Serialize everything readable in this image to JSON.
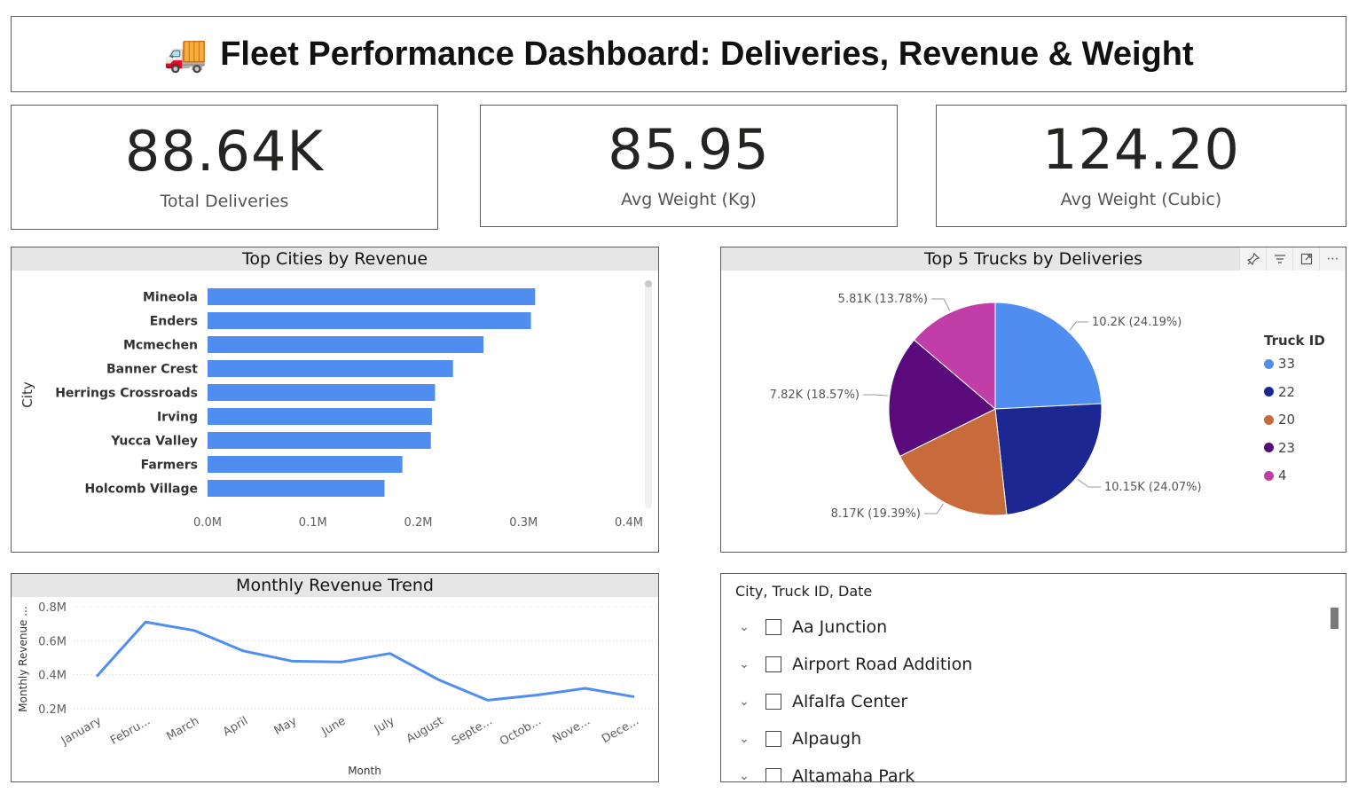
{
  "header": {
    "emoji": "🚚",
    "title": "Fleet Performance Dashboard: Deliveries, Revenue & Weight"
  },
  "kpis": [
    {
      "value": "88.64K",
      "label": "Total Deliveries"
    },
    {
      "value": "85.95",
      "label": "Avg Weight (Kg)"
    },
    {
      "value": "124.20",
      "label": "Avg Weight (Cubic)"
    }
  ],
  "icons": {
    "pin": "pin-icon",
    "filter": "filter-icon",
    "focus": "focus-mode-icon",
    "more": "more-options-icon",
    "chevron": "chevron-down-icon",
    "truck": "truck-icon"
  },
  "colors": {
    "bar": "#4f8ef0",
    "line": "#4f8ef0",
    "pie": [
      "#4f8ef0",
      "#1c2791",
      "#c96a3a",
      "#5b0a7c",
      "#c13ea8"
    ]
  },
  "chart_data": [
    {
      "type": "bar",
      "title": "Top Cities by Revenue",
      "ylabel": "City",
      "categories": [
        "Mineola",
        "Enders",
        "Mcmechen",
        "Banner Crest",
        "Herrings Crossroads",
        "Irving",
        "Yucca Valley",
        "Farmers",
        "Holcomb Village"
      ],
      "values": [
        0.311,
        0.307,
        0.262,
        0.233,
        0.216,
        0.213,
        0.212,
        0.185,
        0.168
      ],
      "xticks": [
        "0.0M",
        "0.1M",
        "0.2M",
        "0.3M",
        "0.4M"
      ],
      "xlim": [
        0,
        0.4
      ]
    },
    {
      "type": "pie",
      "title": "Top 5 Trucks by Deliveries",
      "legend_title": "Truck ID",
      "legend": "right",
      "slices": [
        {
          "name": "33",
          "value": 10.2,
          "label": "10.2K (24.19%)"
        },
        {
          "name": "22",
          "value": 10.15,
          "label": "10.15K (24.07%)"
        },
        {
          "name": "20",
          "value": 8.17,
          "label": "8.17K (19.39%)"
        },
        {
          "name": "23",
          "value": 7.82,
          "label": "7.82K (18.57%)"
        },
        {
          "name": "4",
          "value": 5.81,
          "label": "5.81K (13.78%)"
        }
      ]
    },
    {
      "type": "line",
      "title": "Monthly Revenue Trend",
      "xlabel": "Month",
      "ylabel": "Monthly Revenue ...",
      "categories": [
        "January",
        "Febru...",
        "March",
        "April",
        "May",
        "June",
        "July",
        "August",
        "Septe...",
        "Octob...",
        "Nove...",
        "Dece..."
      ],
      "values": [
        0.39,
        0.71,
        0.66,
        0.54,
        0.48,
        0.475,
        0.525,
        0.37,
        0.25,
        0.28,
        0.32,
        0.27
      ],
      "yticks": [
        "0.2M",
        "0.4M",
        "0.6M",
        "0.8M"
      ],
      "ylim": [
        0.2,
        0.8
      ],
      "grid": true
    }
  ],
  "slicer": {
    "header": "City, Truck ID, Date",
    "items": [
      "Aa Junction",
      "Airport Road Addition",
      "Alfalfa Center",
      "Alpaugh",
      "Altamaha Park"
    ]
  }
}
